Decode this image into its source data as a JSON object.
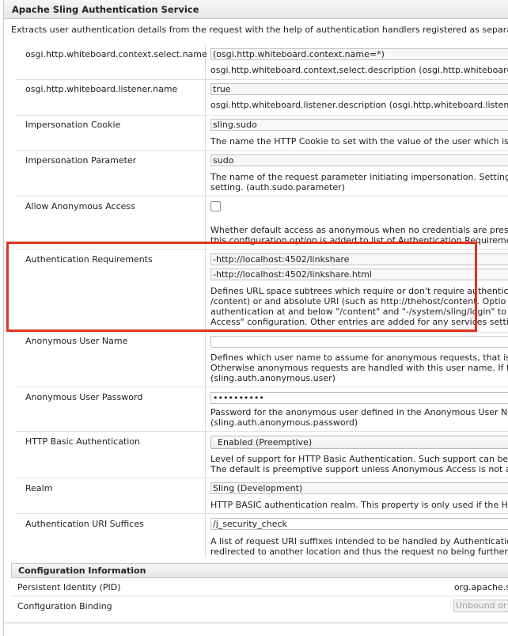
{
  "title": "Apache Sling Authentication Service",
  "intro": "Extracts user authentication details from the request with the help of authentication handlers registered as separate",
  "rows": {
    "context_select": {
      "label": "osgi.http.whiteboard.context.select.name",
      "value": "(osgi.http.whiteboard.context.name=*)",
      "desc": [
        "osgi.http.whiteboard.context.select.description (osgi.http.whiteboard.c"
      ]
    },
    "listener_name": {
      "label": "osgi.http.whiteboard.listener.name",
      "value": "true",
      "desc": [
        "osgi.http.whiteboard.listener.description (osgi.http.whiteboard.listene"
      ]
    },
    "imp_cookie": {
      "label": "Impersonation Cookie",
      "value": "sling.sudo",
      "desc": [
        "The name the HTTP Cookie to set with the value of the user which is t"
      ]
    },
    "imp_param": {
      "label": "Impersonation Parameter",
      "value": "sudo",
      "desc": [
        "The name of the request parameter initiating impersonation. Setting t",
        "setting. (auth.sudo.parameter)"
      ]
    },
    "anon_access": {
      "label": "Allow Anonymous Access",
      "checked": false,
      "desc": [
        "Whether default access as anonymous when no credentials are preser",
        "this configuration option is added to list of Authentication Requirement"
      ]
    },
    "auth_req": {
      "label": "Authentication Requirements",
      "values": [
        "-http://localhost:4502/linkshare",
        "-http://localhost:4502/linkshare.html"
      ],
      "desc": [
        "Defines URL space subtrees which require or don't require authenticat",
        "/content) or and absolute URI (such as http://thehost/content. Optio",
        "authentication at and below \"/content\" and \"-/system/sling/login\" to n",
        "Access\" configuration. Other entries are added for any services setting"
      ]
    },
    "anon_user": {
      "label": "Anonymous User Name",
      "value": "",
      "desc": [
        "Defines which user name to assume for anonymous requests, that is n",
        "Otherwise anonymous requests are handled with this user name. If th",
        "(sling.auth.anonymous.user)"
      ]
    },
    "anon_pass": {
      "label": "Anonymous User Password",
      "value": "••••••••••",
      "desc": [
        "Password for the anonymous user defined in the Anonymous User Nar",
        "(sling.auth.anonymous.password)"
      ]
    },
    "basic_auth": {
      "label": "HTTP Basic Authentication",
      "selected": "Enabled (Preemptive)",
      "desc": [
        "Level of support for HTTP Basic Authentication. Such support can be p",
        "The default is preemptive support unless Anonymous Access is not allo"
      ]
    },
    "realm": {
      "label": "Realm",
      "value": "Sling (Development)",
      "desc": [
        "HTTP BASIC authentication realm. This property is only used if the HT"
      ]
    },
    "uri_suffix": {
      "label": "Authentication URI Suffices",
      "value": "/j_security_check",
      "desc": [
        "A list of request URI suffixes intended to be handled by Authenticatio",
        "redirected to another location and thus the request no being further p"
      ]
    }
  },
  "config_info": {
    "header": "Configuration Information",
    "pid_label": "Persistent Identity (PID)",
    "pid_value": "org.apache.s",
    "binding_label": "Configuration Binding",
    "binding_value": "Unbound or"
  }
}
